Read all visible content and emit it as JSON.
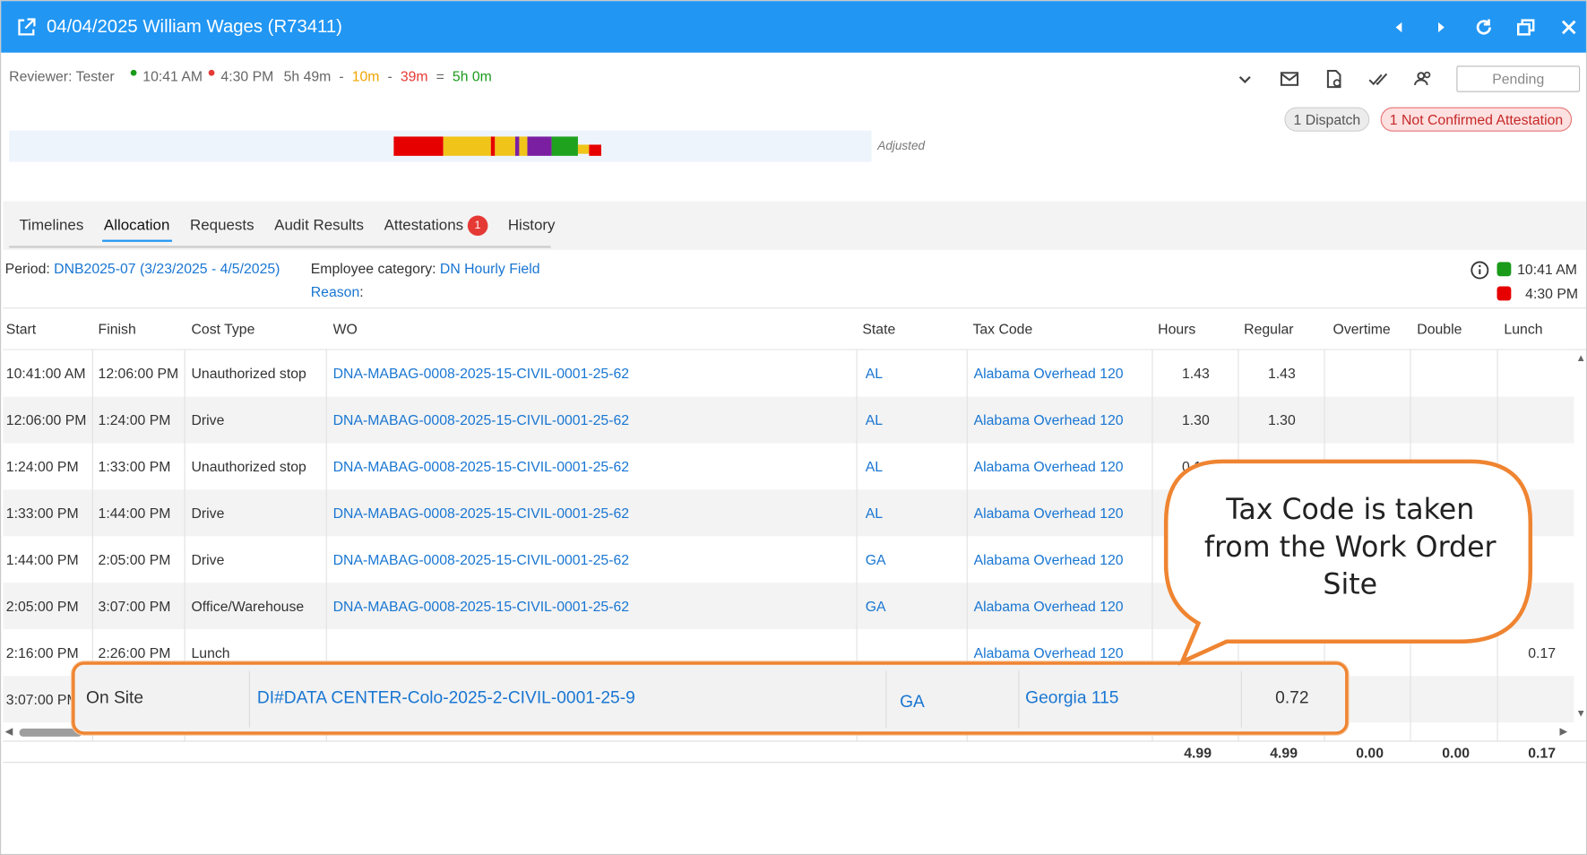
{
  "window": {
    "title": "04/04/2025 William Wages (R73411)"
  },
  "summary": {
    "reviewer": "Reviewer: Tester",
    "start_time": "10:41 AM",
    "end_time": "4:30 PM",
    "duration": "5h 49m",
    "minus1": "-",
    "deduct1": "10m",
    "minus2": "-",
    "deduct2": "39m",
    "equals": "=",
    "net": "5h 0m",
    "colors": {
      "start_dot": "#1a9b1a",
      "end_dot": "#e53935",
      "deduct1": "#f0a500",
      "deduct2": "#e53935",
      "net": "#1a9b1a"
    }
  },
  "toolbar": {
    "status_button": "Pending",
    "dispatch_badge": "1 Dispatch",
    "attestation_badge": "1 Not Confirmed Attestation"
  },
  "timeline": {
    "label": "Adjusted",
    "segments": [
      {
        "color": "#e60000"
      },
      {
        "color": "#f0c419"
      },
      {
        "color": "#e60000"
      },
      {
        "color": "#f0c419"
      },
      {
        "color": "#7b1fa2"
      },
      {
        "color": "#f0c419"
      },
      {
        "color": "#7b1fa2"
      },
      {
        "color": "#1fa31f"
      },
      {
        "color": "#f0c419"
      },
      {
        "color": "#e60000"
      }
    ]
  },
  "tabs": [
    {
      "label": "Timelines"
    },
    {
      "label": "Allocation",
      "active": true
    },
    {
      "label": "Requests"
    },
    {
      "label": "Audit Results"
    },
    {
      "label": "Attestations",
      "badge": "1"
    },
    {
      "label": "History"
    }
  ],
  "period": {
    "label": "Period: ",
    "value": "DNB2025-07 (3/23/2025 - 4/5/2025)",
    "employee_category_label": "Employee category: ",
    "employee_category": "DN Hourly Field",
    "reason_label": "Reason",
    "reason_colon": ":"
  },
  "legend": {
    "start": "10:41 AM",
    "end": "4:30 PM",
    "start_color": "#1a9b1a",
    "end_color": "#e53935"
  },
  "table": {
    "columns": [
      "Start",
      "Finish",
      "Cost Type",
      "WO",
      "State",
      "Tax Code",
      "Hours",
      "Regular",
      "Overtime",
      "Double",
      "Lunch"
    ],
    "rows": [
      {
        "start": "10:41:00 AM",
        "finish": "12:06:00 PM",
        "cost_type": "Unauthorized stop",
        "wo": "DNA-MABAG-0008-2025-15-CIVIL-0001-25-62",
        "state": "AL",
        "tax_code": "Alabama Overhead 120",
        "hours": "1.43",
        "regular": "1.43",
        "overtime": "",
        "double": "",
        "lunch": ""
      },
      {
        "start": "12:06:00 PM",
        "finish": "1:24:00 PM",
        "cost_type": "Drive",
        "wo": "DNA-MABAG-0008-2025-15-CIVIL-0001-25-62",
        "state": "AL",
        "tax_code": "Alabama Overhead 120",
        "hours": "1.30",
        "regular": "1.30",
        "overtime": "",
        "double": "",
        "lunch": ""
      },
      {
        "start": "1:24:00 PM",
        "finish": "1:33:00 PM",
        "cost_type": "Unauthorized stop",
        "wo": "DNA-MABAG-0008-2025-15-CIVIL-0001-25-62",
        "state": "AL",
        "tax_code": "Alabama Overhead 120",
        "hours": "0.14",
        "regular": "",
        "overtime": "",
        "double": "",
        "lunch": ""
      },
      {
        "start": "1:33:00 PM",
        "finish": "1:44:00 PM",
        "cost_type": "Drive",
        "wo": "DNA-MABAG-0008-2025-15-CIVIL-0001-25-62",
        "state": "AL",
        "tax_code": "Alabama Overhead 120",
        "hours": "",
        "regular": "",
        "overtime": "",
        "double": "",
        "lunch": ""
      },
      {
        "start": "1:44:00 PM",
        "finish": "2:05:00 PM",
        "cost_type": "Drive",
        "wo": "DNA-MABAG-0008-2025-15-CIVIL-0001-25-62",
        "state": "GA",
        "tax_code": "Alabama Overhead 120",
        "hours": "",
        "regular": "",
        "overtime": "",
        "double": "",
        "lunch": ""
      },
      {
        "start": "2:05:00 PM",
        "finish": "3:07:00 PM",
        "cost_type": "Office/Warehouse",
        "wo": "DNA-MABAG-0008-2025-15-CIVIL-0001-25-62",
        "state": "GA",
        "tax_code": "Alabama Overhead 120",
        "hours": "",
        "regular": "",
        "overtime": "",
        "double": "",
        "lunch": ""
      },
      {
        "start": "2:16:00 PM",
        "finish": "2:26:00 PM",
        "cost_type": "Lunch",
        "wo": "",
        "state": "",
        "tax_code": "Alabama Overhead 120",
        "hours": "",
        "regular": "",
        "overtime": "",
        "double": "",
        "lunch": "0.17"
      },
      {
        "start": "3:07:00 PM",
        "finish": "",
        "cost_type": "",
        "wo": "",
        "state": "",
        "tax_code": "",
        "hours": "",
        "regular": "",
        "overtime": "",
        "double": "",
        "lunch": ""
      }
    ],
    "totals": {
      "hours": "4.99",
      "regular": "4.99",
      "overtime": "0.00",
      "double": "0.00",
      "lunch": "0.17"
    }
  },
  "highlight_row": {
    "cost_type": "On Site",
    "wo": "DI#DATA CENTER-Colo-2025-2-CIVIL-0001-25-9",
    "state": "GA",
    "tax_code": "Georgia 115",
    "hours": "0.72"
  },
  "callout": {
    "line1": "Tax Code is taken",
    "line2": "from the Work Order",
    "line3": "Site",
    "border_color": "#ef8431"
  }
}
